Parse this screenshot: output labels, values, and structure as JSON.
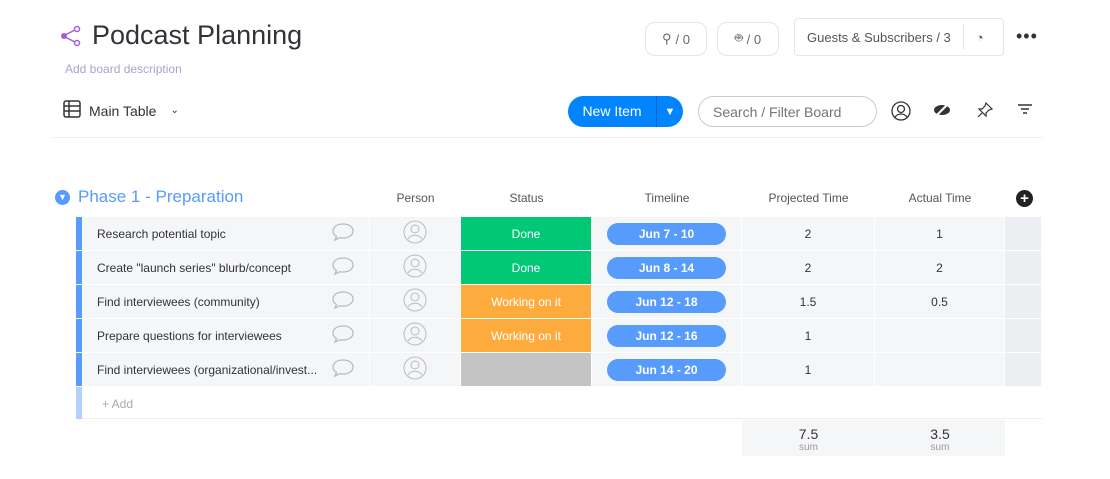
{
  "board": {
    "title": "Podcast Planning",
    "description": "Add board description"
  },
  "header": {
    "integrations_count": "/ 0",
    "automations_count": "/ 0",
    "guests": "Guests & Subscribers / 3",
    "more": "•••"
  },
  "toolbar": {
    "view": "Main Table",
    "new_item": "New Item",
    "search_placeholder": "Search / Filter Board"
  },
  "group": {
    "title": "Phase 1 - Preparation",
    "color": "#579bfc",
    "columns": [
      "Person",
      "Status",
      "Timeline",
      "Projected Time",
      "Actual Time"
    ],
    "rows": [
      {
        "name": "Research potential topic",
        "status": "Done",
        "status_color": "#00c875",
        "timeline": "Jun 7 - 10",
        "projected": "2",
        "actual": "1"
      },
      {
        "name": "Create \"launch series\" blurb/concept",
        "status": "Done",
        "status_color": "#00c875",
        "timeline": "Jun 8 - 14",
        "projected": "2",
        "actual": "2"
      },
      {
        "name": "Find interviewees (community)",
        "status": "Working on it",
        "status_color": "#fdab3d",
        "timeline": "Jun 12 - 18",
        "projected": "1.5",
        "actual": "0.5"
      },
      {
        "name": "Prepare questions for interviewees",
        "status": "Working on it",
        "status_color": "#fdab3d",
        "timeline": "Jun 12 - 16",
        "projected": "1",
        "actual": ""
      },
      {
        "name": "Find interviewees (organizational/invest...",
        "status": "",
        "status_color": "#c4c4c4",
        "timeline": "Jun 14 - 20",
        "projected": "1",
        "actual": ""
      }
    ],
    "add_label": "+ Add",
    "sums": {
      "projected": "7.5",
      "actual": "3.5",
      "label": "sum"
    }
  }
}
